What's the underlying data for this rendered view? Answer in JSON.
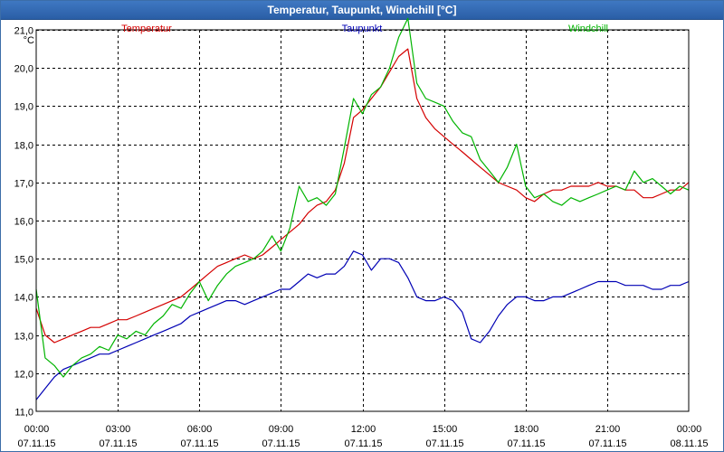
{
  "window": {
    "title": "Temperatur, Taupunkt, Windchill [°C]"
  },
  "chart_data": {
    "type": "line",
    "title": "Temperatur, Taupunkt, Windchill [°C]",
    "ylabel": "°C",
    "ylim": [
      11.0,
      21.0
    ],
    "yticks": [
      "11,0",
      "12,0",
      "13,0",
      "14,0",
      "15,0",
      "16,0",
      "17,0",
      "18,0",
      "19,0",
      "20,0",
      "21,0"
    ],
    "xlim": [
      0,
      24
    ],
    "xtick_times": [
      "00:00",
      "03:00",
      "06:00",
      "09:00",
      "12:00",
      "15:00",
      "18:00",
      "21:00",
      "00:00"
    ],
    "xtick_dates": [
      "07.11.15",
      "07.11.15",
      "07.11.15",
      "07.11.15",
      "07.11.15",
      "07.11.15",
      "07.11.15",
      "07.11.15",
      "08.11.15"
    ],
    "grid": true,
    "legend_position": "top",
    "series": [
      {
        "name": "Temperatur",
        "color": "#d40000",
        "x": [
          0,
          0.33,
          0.67,
          1,
          1.33,
          1.67,
          2,
          2.33,
          2.67,
          3,
          3.33,
          3.67,
          4,
          4.33,
          4.67,
          5,
          5.33,
          5.67,
          6,
          6.33,
          6.67,
          7,
          7.33,
          7.67,
          8,
          8.33,
          8.67,
          9,
          9.33,
          9.67,
          10,
          10.33,
          10.67,
          11,
          11.33,
          11.67,
          12,
          12.33,
          12.67,
          13,
          13.33,
          13.67,
          14,
          14.33,
          14.67,
          15,
          15.33,
          15.67,
          16,
          16.33,
          16.67,
          17,
          17.33,
          17.67,
          18,
          18.33,
          18.67,
          19,
          19.33,
          19.67,
          20,
          20.33,
          20.67,
          21,
          21.33,
          21.67,
          22,
          22.33,
          22.67,
          23,
          23.33,
          23.67,
          24
        ],
        "values": [
          13.7,
          13.0,
          12.8,
          12.9,
          13.0,
          13.1,
          13.2,
          13.2,
          13.3,
          13.4,
          13.4,
          13.5,
          13.6,
          13.7,
          13.8,
          13.9,
          14.0,
          14.2,
          14.4,
          14.6,
          14.8,
          14.9,
          15.0,
          15.1,
          15.0,
          15.1,
          15.3,
          15.5,
          15.7,
          15.9,
          16.2,
          16.4,
          16.5,
          16.8,
          17.5,
          18.7,
          18.9,
          19.2,
          19.5,
          19.9,
          20.3,
          20.5,
          19.2,
          18.7,
          18.4,
          18.2,
          18.0,
          17.8,
          17.6,
          17.4,
          17.2,
          17.0,
          16.9,
          16.8,
          16.6,
          16.5,
          16.7,
          16.8,
          16.8,
          16.9,
          16.9,
          16.9,
          17.0,
          16.9,
          16.9,
          16.8,
          16.8,
          16.6,
          16.6,
          16.7,
          16.8,
          16.8,
          17.0
        ]
      },
      {
        "name": "Taupunkt",
        "color": "#0000b4",
        "x": [
          0,
          0.33,
          0.67,
          1,
          1.33,
          1.67,
          2,
          2.33,
          2.67,
          3,
          3.33,
          3.67,
          4,
          4.33,
          4.67,
          5,
          5.33,
          5.67,
          6,
          6.33,
          6.67,
          7,
          7.33,
          7.67,
          8,
          8.33,
          8.67,
          9,
          9.33,
          9.67,
          10,
          10.33,
          10.67,
          11,
          11.33,
          11.67,
          12,
          12.33,
          12.67,
          13,
          13.33,
          13.67,
          14,
          14.33,
          14.67,
          15,
          15.33,
          15.67,
          16,
          16.33,
          16.67,
          17,
          17.33,
          17.67,
          18,
          18.33,
          18.67,
          19,
          19.33,
          19.67,
          20,
          20.33,
          20.67,
          21,
          21.33,
          21.67,
          22,
          22.33,
          22.67,
          23,
          23.33,
          23.67,
          24
        ],
        "values": [
          11.3,
          11.6,
          11.9,
          12.1,
          12.2,
          12.3,
          12.4,
          12.5,
          12.5,
          12.6,
          12.7,
          12.8,
          12.9,
          13.0,
          13.1,
          13.2,
          13.3,
          13.5,
          13.6,
          13.7,
          13.8,
          13.9,
          13.9,
          13.8,
          13.9,
          14.0,
          14.1,
          14.2,
          14.2,
          14.4,
          14.6,
          14.5,
          14.6,
          14.6,
          14.8,
          15.2,
          15.1,
          14.7,
          15.0,
          15.0,
          14.9,
          14.5,
          14.0,
          13.9,
          13.9,
          14.0,
          13.9,
          13.6,
          12.9,
          12.8,
          13.1,
          13.5,
          13.8,
          14.0,
          14.0,
          13.9,
          13.9,
          14.0,
          14.0,
          14.1,
          14.2,
          14.3,
          14.4,
          14.4,
          14.4,
          14.3,
          14.3,
          14.3,
          14.2,
          14.2,
          14.3,
          14.3,
          14.4
        ]
      },
      {
        "name": "Windchill",
        "color": "#00b400",
        "x": [
          0,
          0.33,
          0.67,
          1,
          1.33,
          1.67,
          2,
          2.33,
          2.67,
          3,
          3.33,
          3.67,
          4,
          4.33,
          4.67,
          5,
          5.33,
          5.67,
          6,
          6.33,
          6.67,
          7,
          7.33,
          7.67,
          8,
          8.33,
          8.67,
          9,
          9.33,
          9.67,
          10,
          10.33,
          10.67,
          11,
          11.33,
          11.67,
          12,
          12.33,
          12.67,
          13,
          13.33,
          13.67,
          14,
          14.33,
          14.67,
          15,
          15.33,
          15.67,
          16,
          16.33,
          16.67,
          17,
          17.33,
          17.67,
          18,
          18.33,
          18.67,
          19,
          19.33,
          19.67,
          20,
          20.33,
          20.67,
          21,
          21.33,
          21.67,
          22,
          22.33,
          22.67,
          23,
          23.33,
          23.67,
          24
        ],
        "values": [
          14.2,
          12.4,
          12.2,
          11.9,
          12.2,
          12.4,
          12.5,
          12.7,
          12.6,
          13.0,
          12.9,
          13.1,
          13.0,
          13.3,
          13.5,
          13.8,
          13.7,
          14.1,
          14.4,
          13.9,
          14.3,
          14.6,
          14.8,
          14.9,
          15.0,
          15.2,
          15.6,
          15.2,
          15.8,
          16.9,
          16.5,
          16.6,
          16.4,
          16.7,
          17.9,
          19.2,
          18.8,
          19.3,
          19.5,
          20.0,
          20.8,
          21.3,
          19.6,
          19.2,
          19.1,
          19.0,
          18.6,
          18.3,
          18.2,
          17.6,
          17.3,
          17.0,
          17.4,
          18.0,
          16.9,
          16.6,
          16.7,
          16.5,
          16.4,
          16.6,
          16.5,
          16.6,
          16.7,
          16.8,
          16.9,
          16.8,
          17.3,
          17.0,
          17.1,
          16.9,
          16.7,
          16.9,
          16.8
        ]
      }
    ]
  }
}
